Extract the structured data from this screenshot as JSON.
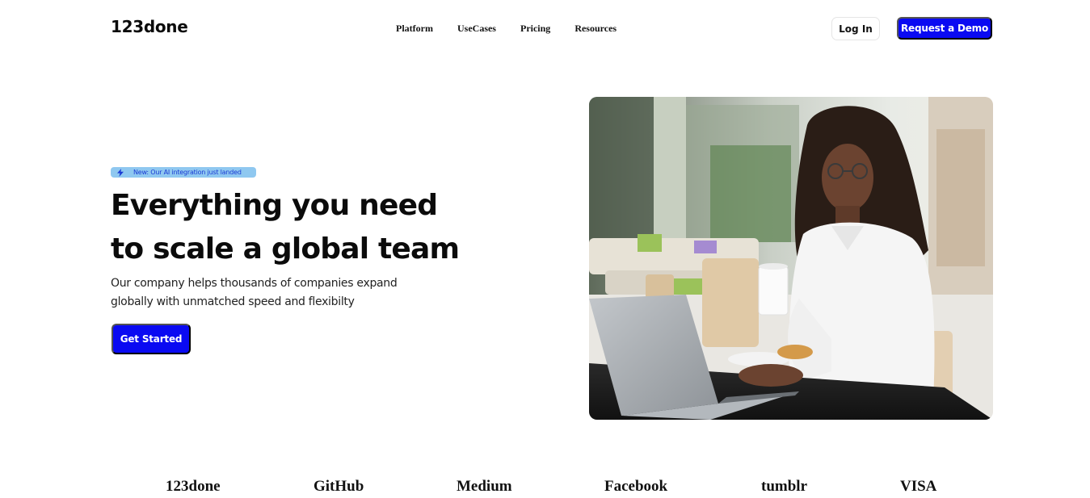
{
  "header": {
    "logo": "123done",
    "nav": [
      "Platform",
      "UseCases",
      "Pricing",
      "Resources"
    ],
    "login_label": "Log In",
    "demo_label": "Request a Demo"
  },
  "hero": {
    "badge_icon": "lightning-icon",
    "badge_text": "New: Our AI integration just landed",
    "title_line1": "Everything you need",
    "title_line2": "to scale a global team",
    "subtitle_line1": "Our company helps thousands of companies expand",
    "subtitle_line2": "globally with unmatched speed and flexibilty",
    "cta_label": "Get Started",
    "image_subject": "woman working on laptop in cafe"
  },
  "brands": [
    "123done",
    "GitHub",
    "Medium",
    "Facebook",
    "tumblr",
    "VISA"
  ],
  "colors": {
    "accent": "#0a0af2",
    "badge_bg": "#8fc8f0",
    "badge_text": "#1a3bd4",
    "text": "#0b0b0b"
  }
}
